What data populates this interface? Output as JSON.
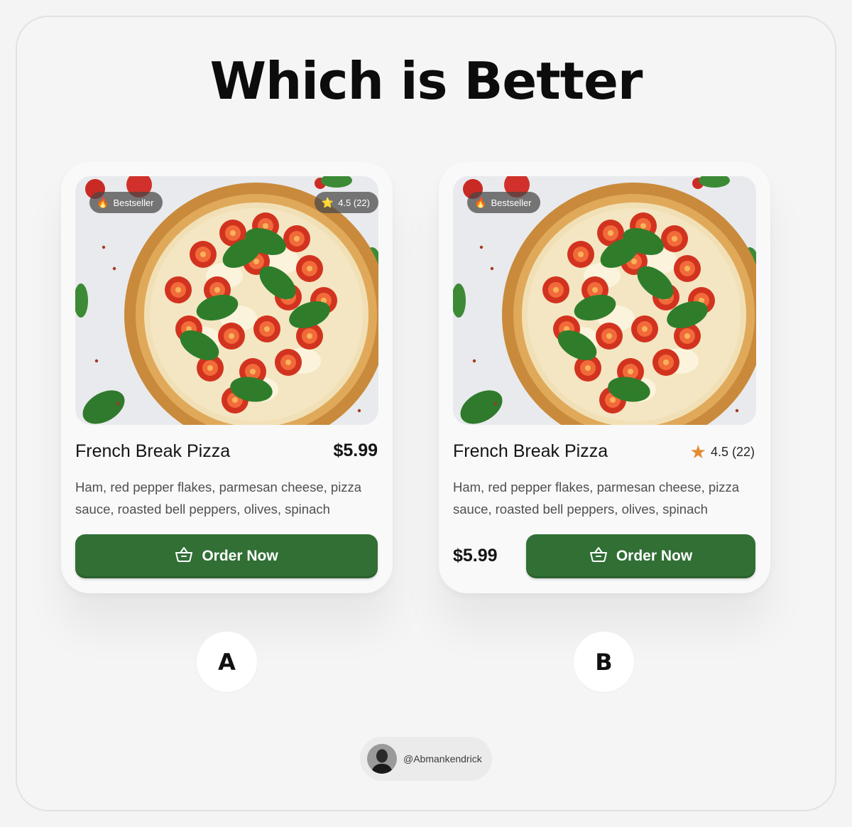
{
  "title": "Which is Better",
  "cards": [
    {
      "badge": {
        "icon": "fire-icon",
        "glyph": "🔥",
        "label": "Bestseller"
      },
      "rating_pill": {
        "icon": "star-icon",
        "glyph": "⭐",
        "label": "4.5 (22)"
      },
      "name": "French Break Pizza",
      "price": "$5.99",
      "description": "Ham, red pepper flakes, parmesan cheese, pizza sauce, roasted bell peppers, olives, spinach",
      "button": {
        "icon": "basket-icon",
        "label": "Order Now"
      },
      "option_label": "A"
    },
    {
      "badge": {
        "icon": "fire-icon",
        "glyph": "🔥",
        "label": "Bestseller"
      },
      "rating": {
        "icon": "star-icon",
        "glyph": "★",
        "label": "4.5 (22)"
      },
      "name": "French Break Pizza",
      "price": "$5.99",
      "description": "Ham, red pepper flakes, parmesan cheese, pizza sauce, roasted bell peppers, olives, spinach",
      "button": {
        "icon": "basket-icon",
        "label": "Order Now"
      },
      "option_label": "B"
    }
  ],
  "credit": {
    "handle": "@Abmankendrick"
  },
  "colors": {
    "button": "#316f35",
    "star_b": "#e48a2f",
    "background": "#f4f4f4",
    "card": "#f9f9f9"
  }
}
